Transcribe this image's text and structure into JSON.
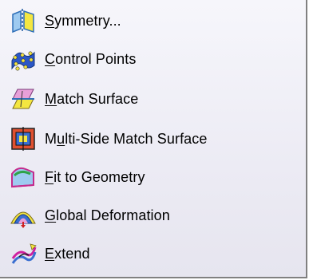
{
  "menu": {
    "items": [
      {
        "mnemonic": "S",
        "rest": "ymmetry...",
        "icon": "symmetry-icon"
      },
      {
        "mnemonic": "C",
        "rest": "ontrol Points",
        "icon": "control-points-icon"
      },
      {
        "mnemonic": "M",
        "rest": "atch Surface",
        "icon": "match-surface-icon"
      },
      {
        "prefix": "M",
        "mnemonic": "u",
        "rest": "lti-Side Match Surface",
        "icon": "multi-side-match-surface-icon"
      },
      {
        "mnemonic": "F",
        "rest": "it to Geometry",
        "icon": "fit-to-geometry-icon"
      },
      {
        "mnemonic": "G",
        "rest": "lobal Deformation",
        "icon": "global-deformation-icon"
      },
      {
        "mnemonic": "E",
        "rest": "xtend",
        "icon": "extend-icon"
      }
    ]
  }
}
